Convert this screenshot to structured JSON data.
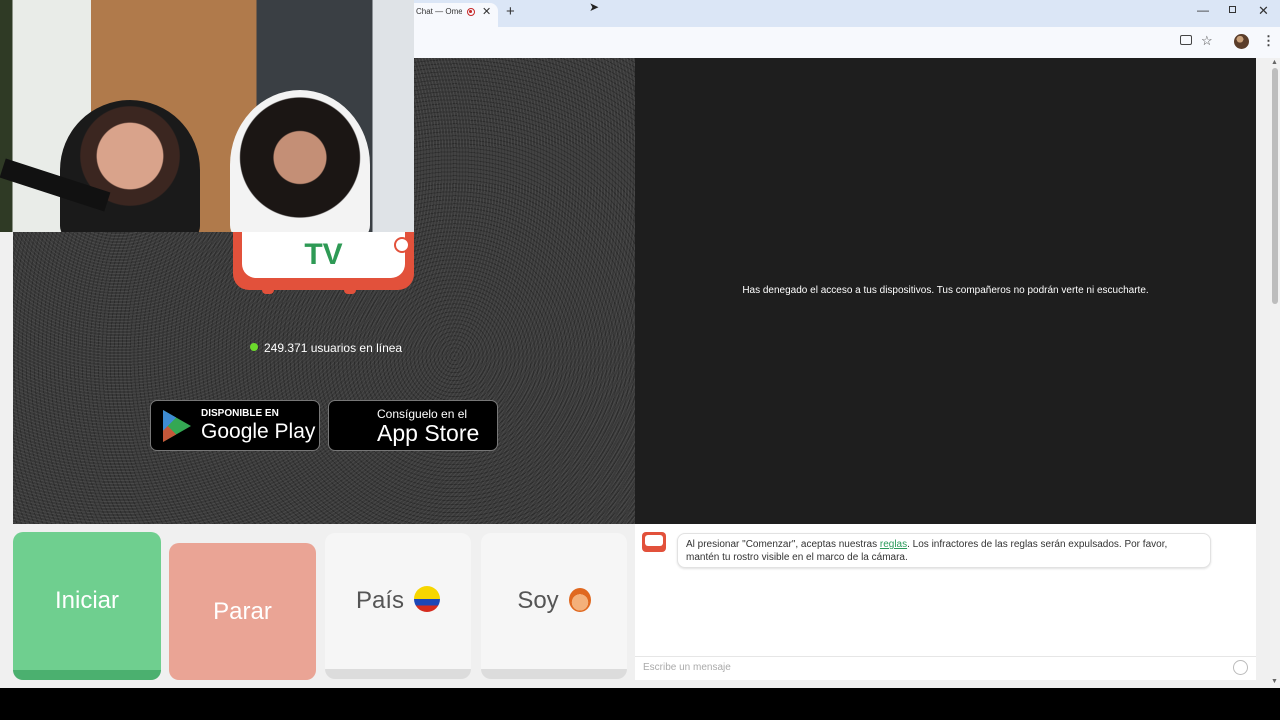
{
  "browser": {
    "tab_title": "Chat — Ome",
    "tab_close": "✕",
    "new_tab": "+",
    "window_controls": {
      "minimize": "—",
      "maximize": "",
      "close": "✕"
    },
    "icons": [
      "cursor-icon",
      "install-icon",
      "star-icon",
      "profile-icon",
      "menu-icon",
      "recording-icon"
    ]
  },
  "video": {
    "denied_message": "Has denegado el acceso a tus dispositivos. Tus compañeros no podrán verte ni escucharte.",
    "logo_text": "TV",
    "online_text": "249.371 usuarios en línea"
  },
  "stores": {
    "google_small": "DISPONIBLE EN",
    "google_big": "Google Play",
    "apple_small": "Consíguelo en el",
    "apple_big": "App Store"
  },
  "controls": {
    "start": "Iniciar",
    "stop": "Parar",
    "country": "País",
    "gender": "Soy"
  },
  "chat": {
    "message_before": "Al presionar \"Comenzar\", aceptas nuestras ",
    "rules_link": "reglas",
    "message_after": ". Los infractores de las reglas serán expulsados. Por favor, mantén tu rostro visible en el marco de la cámara.",
    "placeholder": "Escribe un mensaje"
  },
  "colors": {
    "start_green": "#6fcf8f",
    "stop_salmon": "#eaa495",
    "brand_red": "#e2513b",
    "brand_green": "#2e9a55",
    "online_dot": "#6bd92b"
  }
}
